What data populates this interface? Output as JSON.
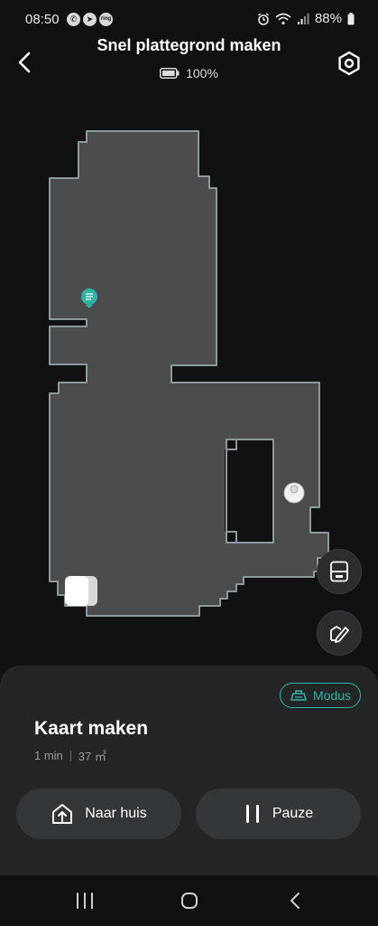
{
  "status_bar": {
    "time": "08:50",
    "app_badges": [
      "whatsapp-icon",
      "signal-icon",
      "ring-icon"
    ],
    "ring_label": "ring",
    "battery_text": "88%"
  },
  "header": {
    "title": "Snel plattegrond maken",
    "battery_percent": "100%"
  },
  "map": {
    "floor_color": "#4c4c4c",
    "wall_color": "#8c9a9e",
    "dock_marker": "dock-icon",
    "robot_marker": "robot-icon",
    "station_marker": "charging-station-icon"
  },
  "side_buttons": [
    {
      "icon": "dock-station-icon"
    },
    {
      "icon": "edit-map-icon"
    }
  ],
  "sheet": {
    "mode_label": "Modus",
    "title": "Kaart maken",
    "duration": "1 min",
    "area": "37 ㎡",
    "home_button": "Naar huis",
    "pause_button": "Pauze"
  },
  "colors": {
    "accent": "#2fb3a4",
    "background": "#111111",
    "sheet": "#232526",
    "button": "#34373a"
  }
}
